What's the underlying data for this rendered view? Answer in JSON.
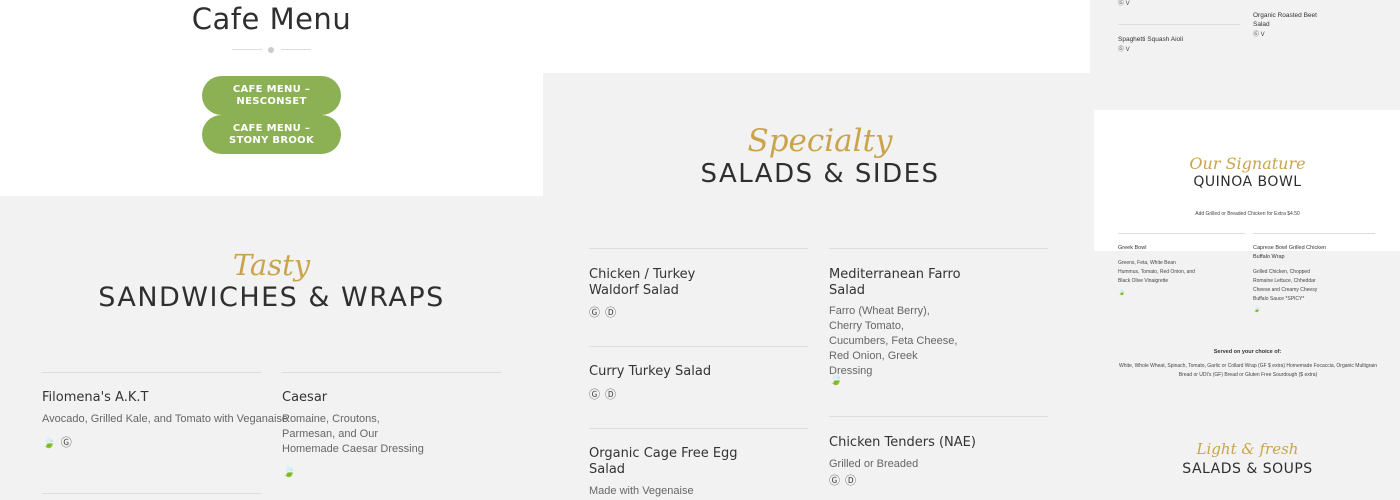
{
  "header": {
    "title": "Cafe Menu",
    "buttons": [
      {
        "label": "CAFE MENU – NESCONSET"
      },
      {
        "label": "CAFE MENU – STONY BROOK"
      }
    ]
  },
  "sandwiches": {
    "script_label": "Tasty",
    "heading": "SANDWICHES & WRAPS",
    "items": [
      {
        "name": "Filomena's A.K.T",
        "description": "Avocado, Grilled Kale, and Tomato with Veganaise",
        "icons": "🍃 Ⓖ"
      },
      {
        "name": "Caesar",
        "description": "Romaine, Croutons, Parmesan, and Our Homemade Caesar Dressing",
        "icons": "🍃"
      }
    ]
  },
  "salads": {
    "script_label": "Specialty",
    "heading": "SALADS & SIDES",
    "items": [
      {
        "name": "Chicken / Turkey Waldorf Salad",
        "description": "",
        "icons": "Ⓖ Ⓓ"
      },
      {
        "name": "Curry Turkey Salad",
        "description": "",
        "icons": "Ⓖ Ⓓ"
      },
      {
        "name": "Organic Cage Free Egg Salad",
        "description": "Made with Vegenaise",
        "icons": ""
      },
      {
        "name": "Mediterranean Farro Salad",
        "description": "Farro (Wheat Berry), Cherry Tomato, Cucumbers, Feta Cheese, Red Onion, Greek Dressing",
        "icons": "🍃"
      },
      {
        "name": "Chicken Tenders (NAE)",
        "description": "Grilled or Breaded",
        "icons": "Ⓖ Ⓓ"
      }
    ]
  },
  "side_panel": {
    "top": {
      "items": [
        {
          "name": "",
          "icons": "Ⓖ V"
        },
        {
          "name": "Organic Roasted Beet Salad",
          "icons": "Ⓖ V"
        },
        {
          "name": "Spaghetti Squash Aioli",
          "icons": "Ⓖ V"
        }
      ]
    },
    "quinoa": {
      "script_label": "Our Signature",
      "heading": "QUINOA BOWL",
      "note": "Add Grilled or Breaded Chicken for Extra $4.50",
      "items": [
        {
          "name": "Greek Bowl",
          "description": "Greens, Feta, White Bean Hummus, Tomato, Red Onion, and Black Olive Vinaigrette",
          "icons": "🍃"
        },
        {
          "name": "Caprese Bowl Grilled Chicken Buffalo Wrap",
          "description": "Grilled Chicken, Chopped Romaine Lettuce, Chheddar Cheese and Creamy Cheesy Buffalo Sauce *SPICY*",
          "icons": "🍃"
        }
      ],
      "served_title": "Served on your choice of:",
      "served_text": "White, Whole Wheat, Spinach, Tomato, Garlic or Collard Wrap (GF $ extra) Homemade Focaccia, Organic Multigrain Bread or UDI's (GF) Bread or Gluten Free Sourdough ($ extra)"
    },
    "light": {
      "script_label": "Light & fresh",
      "heading": "SALADS & SOUPS"
    }
  }
}
